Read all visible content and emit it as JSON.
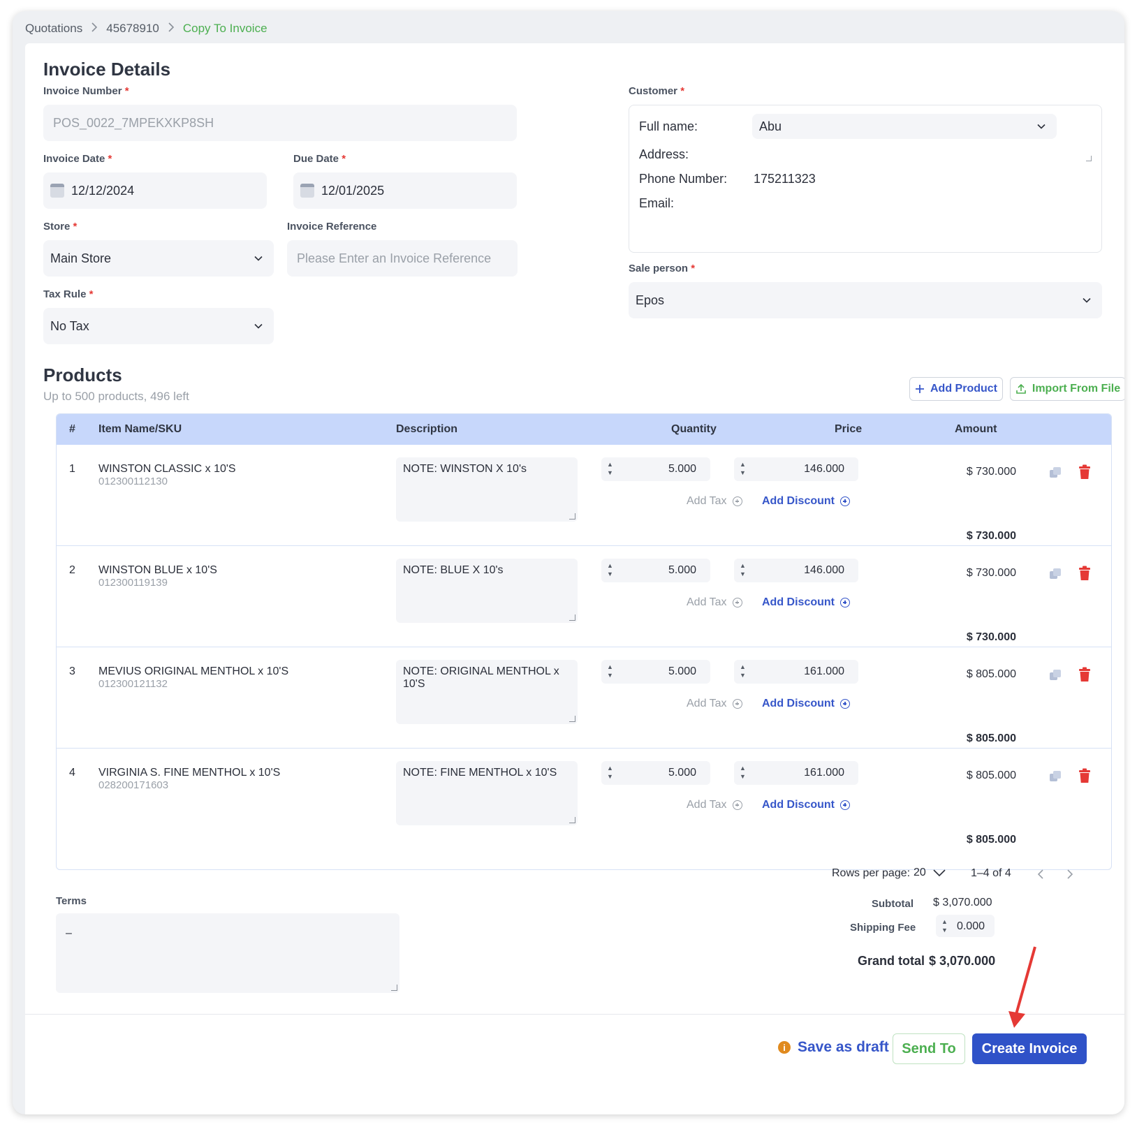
{
  "breadcrumb": {
    "item1": "Quotations",
    "item2": "45678910",
    "current": "Copy To Invoice"
  },
  "invoice": {
    "title": "Invoice Details",
    "number_label": "Invoice Number",
    "number_value": "POS_0022_7MPEKXKP8SH",
    "date_label": "Invoice Date",
    "date_value": "12/12/2024",
    "due_label": "Due Date",
    "due_value": "12/01/2025",
    "store_label": "Store",
    "store_value": "Main Store",
    "ref_label": "Invoice Reference",
    "ref_placeholder": "Please Enter an Invoice Reference",
    "tax_label": "Tax Rule",
    "tax_value": "No Tax",
    "required_mark": "*"
  },
  "customer": {
    "label": "Customer",
    "fullname_label": "Full name:",
    "fullname_value": "Abu",
    "address_label": "Address:",
    "phone_label": "Phone Number:",
    "phone_value": "175211323",
    "email_label": "Email:",
    "saleperson_label": "Sale person",
    "saleperson_value": "Epos"
  },
  "products": {
    "title": "Products",
    "subtitle": "Up to 500 products, 496 left",
    "add_product": "Add Product",
    "import_file": "Import From File",
    "columns": [
      "#",
      "Item Name/SKU",
      "Description",
      "Quantity",
      "Price",
      "Amount"
    ],
    "add_tax": "Add Tax",
    "add_discount": "Add Discount",
    "rows": [
      {
        "num": "1",
        "name": "WINSTON CLASSIC x 10'S",
        "sku": "012300112130",
        "desc": "NOTE: WINSTON X 10's",
        "qty": "5.000",
        "price": "146.000",
        "amount": "$ 730.000",
        "total": "$ 730.000"
      },
      {
        "num": "2",
        "name": "WINSTON BLUE x 10'S",
        "sku": "012300119139",
        "desc": "NOTE: BLUE X 10's",
        "qty": "5.000",
        "price": "146.000",
        "amount": "$ 730.000",
        "total": "$ 730.000"
      },
      {
        "num": "3",
        "name": "MEVIUS ORIGINAL MENTHOL x 10'S",
        "sku": "012300121132",
        "desc": "NOTE: ORIGINAL MENTHOL x 10'S",
        "qty": "5.000",
        "price": "161.000",
        "amount": "$ 805.000",
        "total": "$ 805.000"
      },
      {
        "num": "4",
        "name": "VIRGINIA S. FINE MENTHOL x 10'S",
        "sku": "028200171603",
        "desc": "NOTE: FINE MENTHOL x 10'S",
        "qty": "5.000",
        "price": "161.000",
        "amount": "$ 805.000",
        "total": "$ 805.000"
      }
    ]
  },
  "pagination": {
    "rows_label": "Rows per page:",
    "rows_value": "20",
    "range": "1–4 of 4"
  },
  "terms": {
    "label": "Terms",
    "value": "–"
  },
  "totals": {
    "subtotal_label": "Subtotal",
    "subtotal_value": "$ 3,070.000",
    "shipping_label": "Shipping Fee",
    "shipping_value": "0.000",
    "grand_label": "Grand total",
    "grand_value": "$ 3,070.000"
  },
  "actions": {
    "save_draft": "Save as draft",
    "send_to": "Send To",
    "create": "Create Invoice"
  },
  "colors": {
    "accent": "#2f52c8",
    "success": "#4caf50",
    "danger": "#e53935",
    "header": "#c7d7fb"
  }
}
